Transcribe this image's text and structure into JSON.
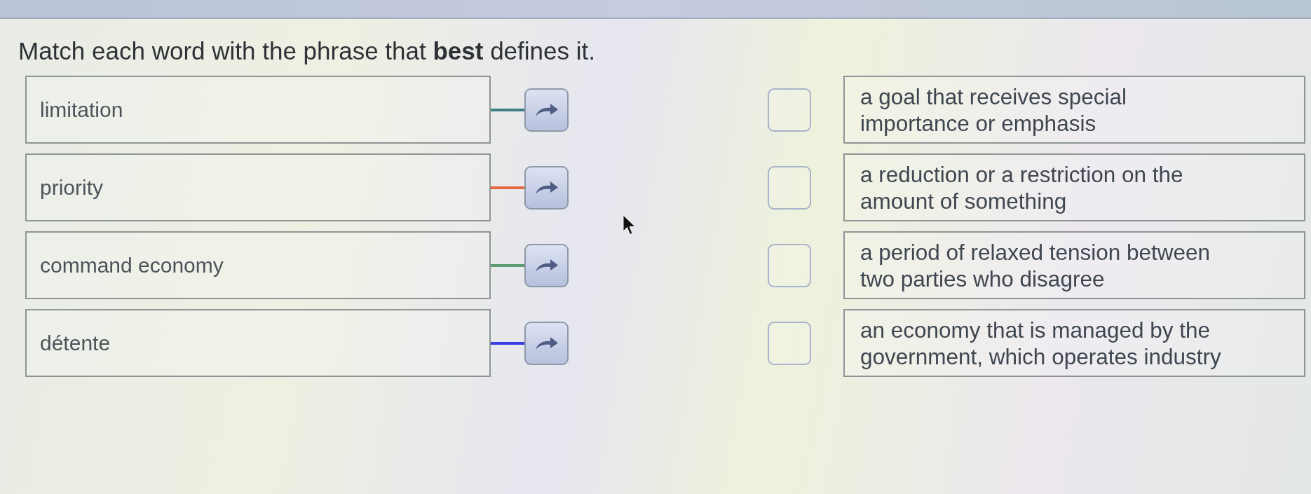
{
  "instruction": "Match each word with the phrase that **best** defines it.",
  "terms": [
    {
      "text": "limitation",
      "color": "#3e7f86"
    },
    {
      "text": "priority",
      "color": "#e8663f"
    },
    {
      "text": "command economy",
      "color": "#5e9a73"
    },
    {
      "text": "détente",
      "color": "#3a3fe0"
    }
  ],
  "definitions": [
    {
      "text": "a goal that receives special importance or emphasis"
    },
    {
      "text": "a reduction or a restriction on the amount of something"
    },
    {
      "text": "a period of relaxed tension between two parties who disagree"
    },
    {
      "text": "an economy that is managed by the government, which operates industry"
    }
  ]
}
